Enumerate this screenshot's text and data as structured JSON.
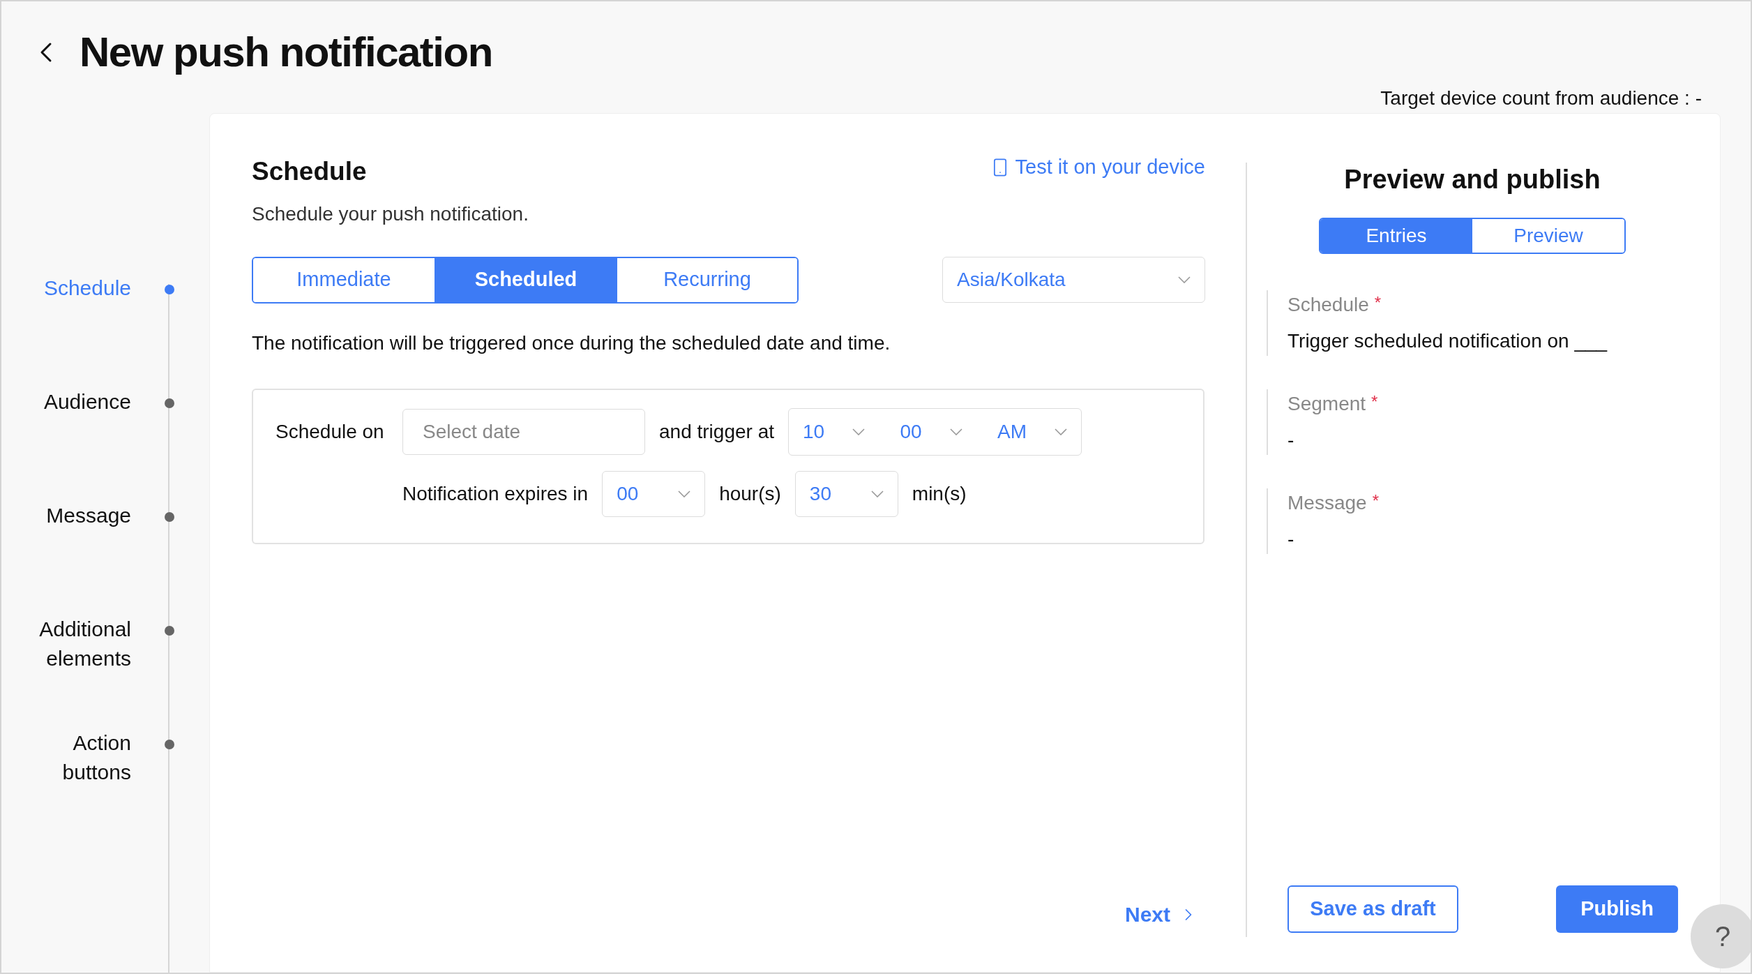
{
  "header": {
    "title": "New push notification",
    "target_count": "Target device count from audience : -"
  },
  "steps": [
    {
      "label": "Schedule",
      "selected": true
    },
    {
      "label": "Audience",
      "selected": false
    },
    {
      "label": "Message",
      "selected": false
    },
    {
      "label": "Additional elements",
      "selected": false
    },
    {
      "label": "Action buttons",
      "selected": false
    }
  ],
  "schedule": {
    "title": "Schedule",
    "subtitle": "Schedule your push notification.",
    "test_link": "Test it on your device",
    "modes": [
      {
        "label": "Immediate",
        "selected": false
      },
      {
        "label": "Scheduled",
        "selected": true
      },
      {
        "label": "Recurring",
        "selected": false
      }
    ],
    "timezone": "Asia/Kolkata",
    "description": "The notification will be triggered once during the scheduled date and time.",
    "schedule_on_label": "Schedule on",
    "date_placeholder": "Select date",
    "trigger_label": "and trigger at",
    "hour": "10",
    "minute": "00",
    "ampm": "AM",
    "expires_label": "Notification expires in",
    "expire_hours": "00",
    "hours_unit": "hour(s)",
    "expire_minutes": "30",
    "minutes_unit": "min(s)",
    "next": "Next"
  },
  "preview": {
    "title": "Preview and publish",
    "tabs": [
      {
        "label": "Entries",
        "selected": true
      },
      {
        "label": "Preview",
        "selected": false
      }
    ],
    "entries": [
      {
        "label": "Schedule",
        "required_mark": "*",
        "value": "Trigger scheduled notification on ___"
      },
      {
        "label": "Segment",
        "required_mark": "*",
        "value": "-"
      },
      {
        "label": "Message",
        "required_mark": "*",
        "value": "-"
      }
    ],
    "save_draft": "Save as draft",
    "publish": "Publish"
  },
  "help": "?"
}
